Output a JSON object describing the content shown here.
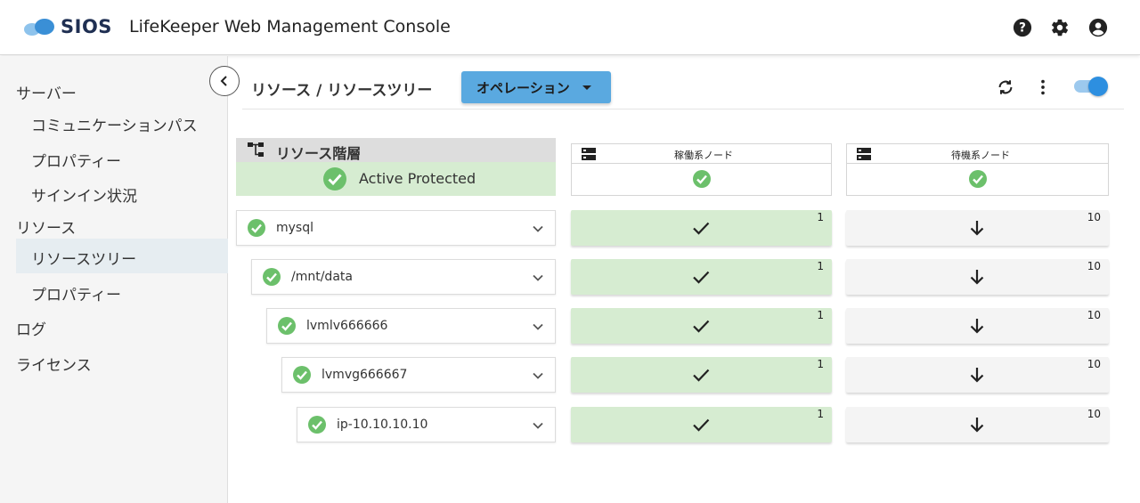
{
  "header": {
    "brand": "SIOS",
    "title": "LifeKeeper Web Management Console",
    "icons": [
      "help-icon",
      "gear-icon",
      "account-icon"
    ]
  },
  "sidebar": {
    "items": [
      {
        "label": "サーバー",
        "level": "top"
      },
      {
        "label": "コミュニケーションパス",
        "level": "sub"
      },
      {
        "label": "プロパティー",
        "level": "sub"
      },
      {
        "label": "サインイン状況",
        "level": "sub"
      },
      {
        "label": "リソース",
        "level": "top"
      },
      {
        "label": "リソースツリー",
        "level": "sub",
        "active": true
      },
      {
        "label": "プロパティー",
        "level": "sub"
      },
      {
        "label": "ログ",
        "level": "top"
      },
      {
        "label": "ライセンス",
        "level": "top"
      }
    ]
  },
  "toolbar": {
    "breadcrumb": "リソース / リソースツリー",
    "operation_label": "オペレーション",
    "icons": [
      "refresh-icon",
      "more-vert-icon"
    ],
    "toggle_on": true
  },
  "hierarchy": {
    "title": "リソース階層",
    "status": "Active Protected"
  },
  "nodes": [
    {
      "label": "稼働系ノード",
      "status": "ok"
    },
    {
      "label": "待機系ノード",
      "status": "ok"
    }
  ],
  "resources": [
    {
      "name": "mysql",
      "active_priority": "1",
      "standby_priority": "10"
    },
    {
      "name": "/mnt/data",
      "active_priority": "1",
      "standby_priority": "10"
    },
    {
      "name": "lvmlv666666",
      "active_priority": "1",
      "standby_priority": "10"
    },
    {
      "name": "lvmvg666667",
      "active_priority": "1",
      "standby_priority": "10"
    },
    {
      "name": "ip-10.10.10.10",
      "active_priority": "1",
      "standby_priority": "10"
    }
  ],
  "colors": {
    "accent": "#5aa9e0",
    "ok_green": "#6cc06b",
    "active_cell": "#d6ecd1",
    "toggle": "#2d8fe0"
  }
}
